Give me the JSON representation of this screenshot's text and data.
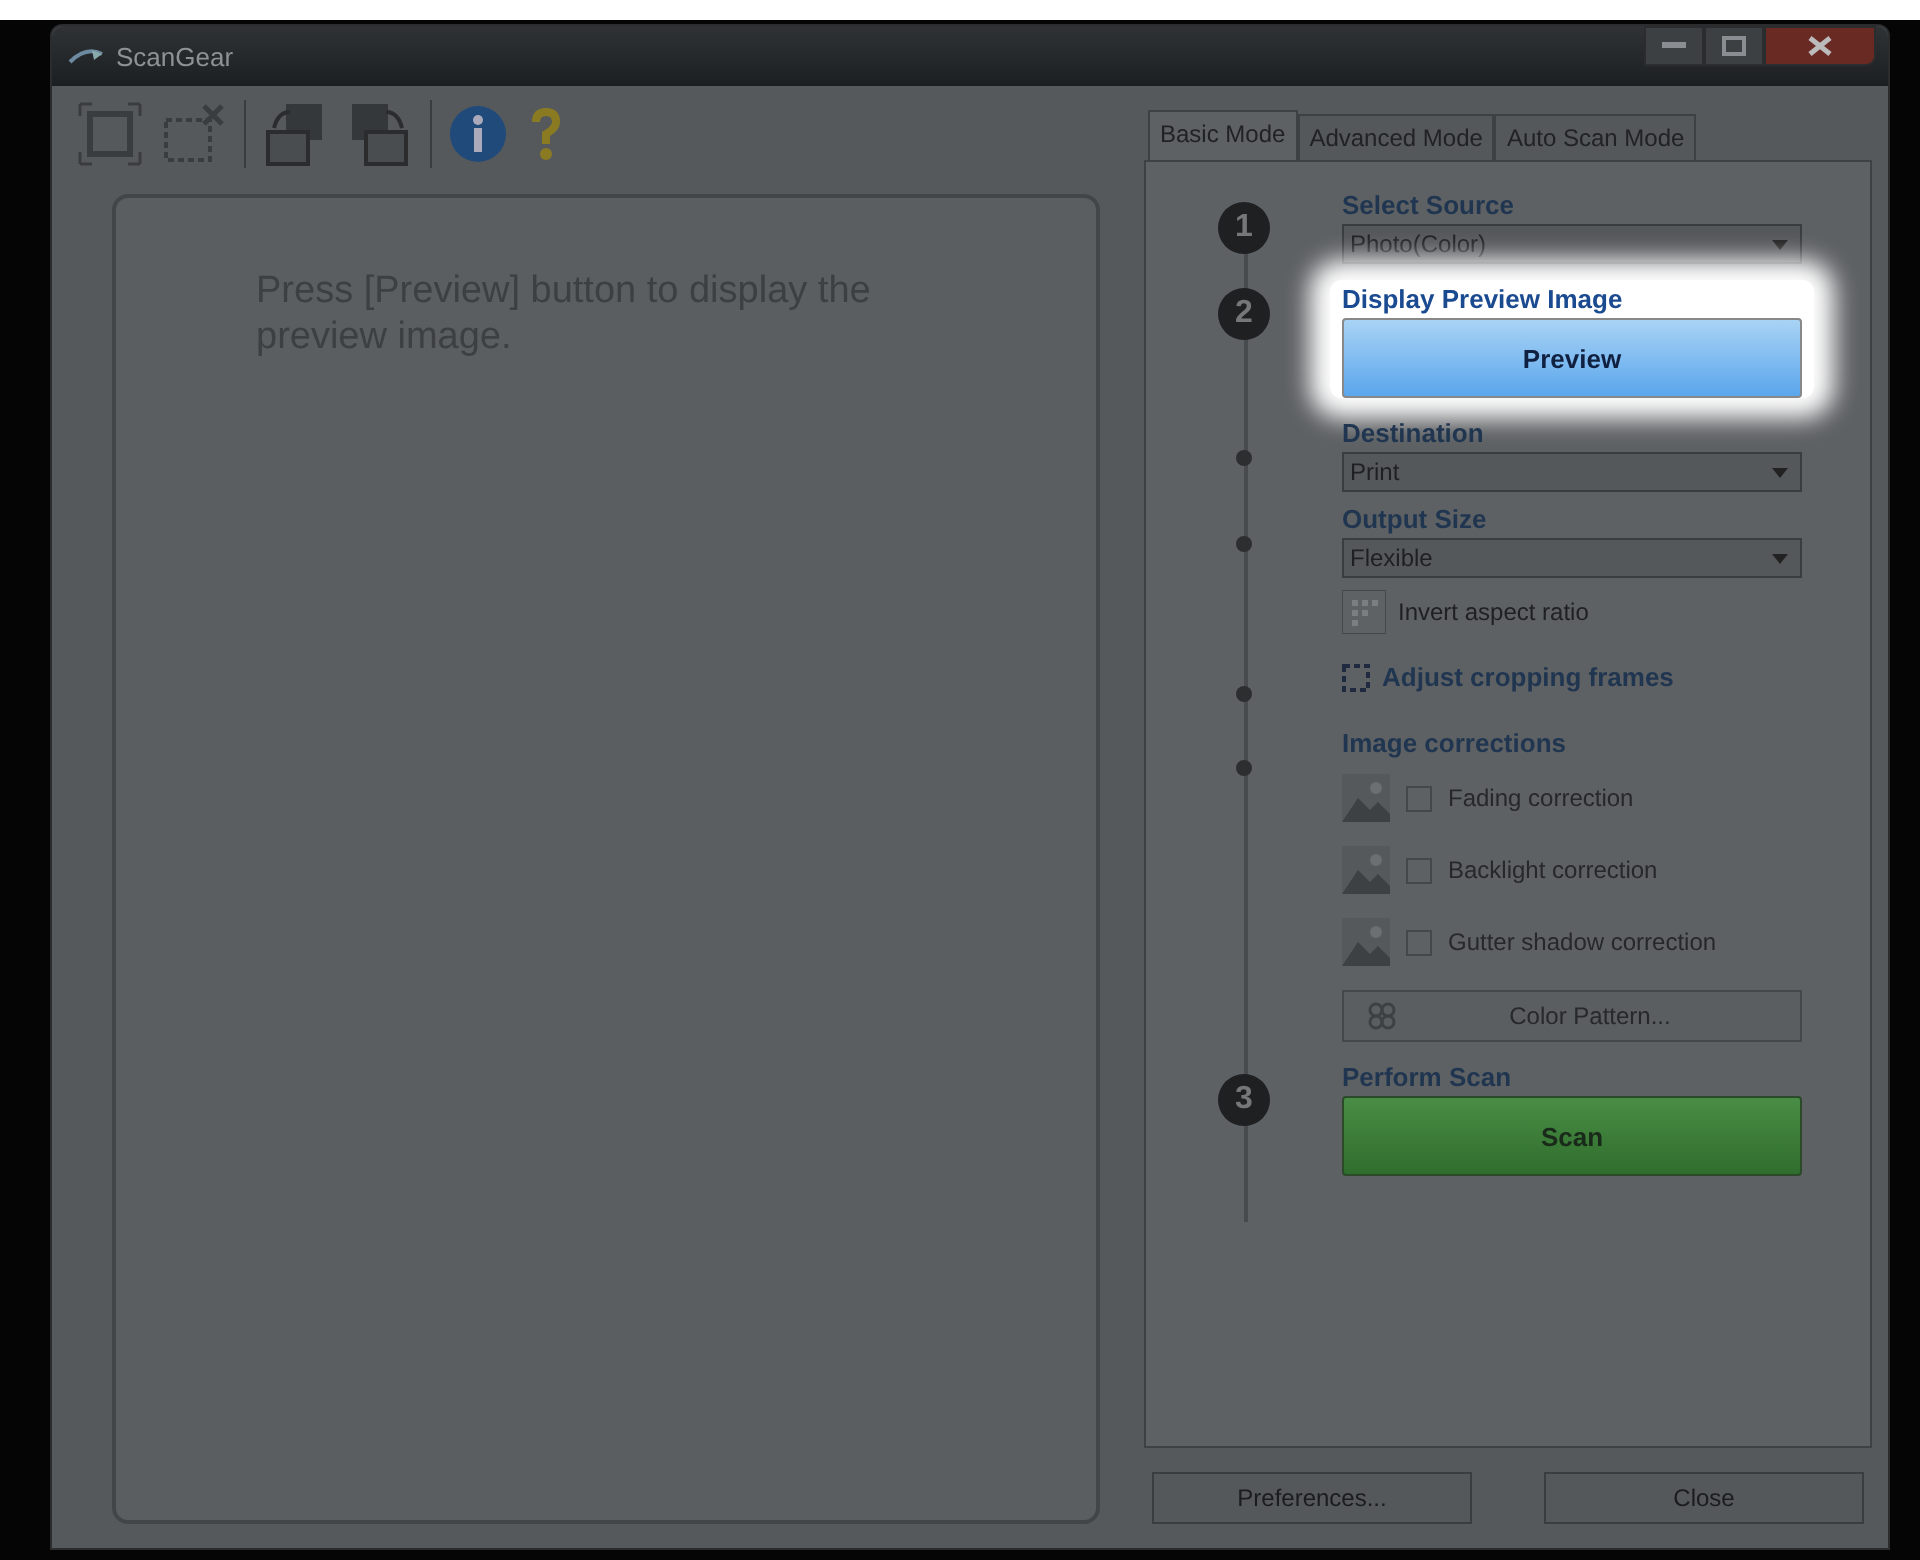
{
  "window": {
    "title": "ScanGear"
  },
  "preview_area": {
    "message": "Press [Preview] button to display the preview image."
  },
  "tabs": [
    {
      "label": "Basic Mode",
      "selected": true
    },
    {
      "label": "Advanced Mode",
      "selected": false
    },
    {
      "label": "Auto Scan Mode",
      "selected": false
    }
  ],
  "steps": [
    {
      "kind": "select",
      "number": "1",
      "title": "Select Source",
      "value": "Photo(Color)"
    },
    {
      "kind": "button",
      "number": "2",
      "title": "Display Preview Image",
      "button": "Preview",
      "highlighted": true
    },
    {
      "kind": "select",
      "title": "Destination",
      "value": "Print"
    },
    {
      "kind": "select",
      "title": "Output Size",
      "value": "Flexible"
    },
    {
      "kind": "option",
      "label": "Invert aspect ratio"
    },
    {
      "kind": "link",
      "label": "Adjust cropping frames"
    },
    {
      "kind": "corrections",
      "title": "Image corrections",
      "items": [
        {
          "label": "Fading correction",
          "checked": false,
          "disabled": true
        },
        {
          "label": "Backlight correction",
          "checked": false,
          "disabled": true
        },
        {
          "label": "Gutter shadow correction",
          "checked": false,
          "disabled": true
        }
      ],
      "button": {
        "label": "Color Pattern...",
        "disabled": true
      }
    },
    {
      "kind": "scan",
      "number": "3",
      "title": "Perform Scan",
      "button": "Scan",
      "highlighted": false
    }
  ],
  "footer_buttons": [
    "Preferences...",
    "Close"
  ]
}
